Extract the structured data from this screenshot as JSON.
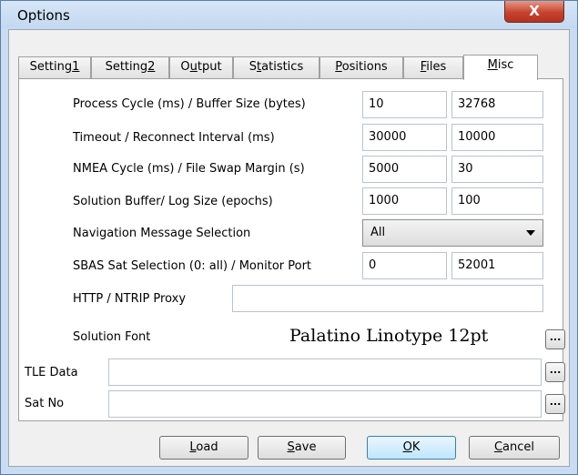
{
  "window": {
    "title": "Options",
    "close_glyph": "X"
  },
  "tabs": [
    {
      "label": "Setting1",
      "pre": "Setting",
      "accel": "1",
      "post": ""
    },
    {
      "label": "Setting2",
      "pre": "Setting",
      "accel": "2",
      "post": ""
    },
    {
      "label": "Output",
      "pre": "O",
      "accel": "u",
      "post": "tput"
    },
    {
      "label": "Statistics",
      "pre": "S",
      "accel": "t",
      "post": "atistics"
    },
    {
      "label": "Positions",
      "pre": "",
      "accel": "P",
      "post": "ositions"
    },
    {
      "label": "Files",
      "pre": "",
      "accel": "F",
      "post": "iles"
    },
    {
      "label": "Misc",
      "pre": "",
      "accel": "M",
      "post": "isc"
    }
  ],
  "active_tab": "Misc",
  "misc": {
    "process_cycle": {
      "label": "Process Cycle (ms) / Buffer Size (bytes)",
      "value1": "10",
      "value2": "32768"
    },
    "timeout": {
      "label": "Timeout / Reconnect Interval (ms)",
      "value1": "30000",
      "value2": "10000"
    },
    "nmea_cycle": {
      "label": "NMEA Cycle (ms) / File Swap Margin (s)",
      "value1": "5000",
      "value2": "30"
    },
    "solution_buffer": {
      "label": "Solution Buffer/ Log Size (epochs)",
      "value1": "1000",
      "value2": "100"
    },
    "nav_msg": {
      "label": "Navigation Message Selection",
      "selected": "All"
    },
    "sbas": {
      "label": "SBAS Sat Selection (0: all) / Monitor Port",
      "value1": "0",
      "value2": "52001"
    },
    "proxy": {
      "label": "HTTP / NTRIP Proxy",
      "value": ""
    },
    "solution_font": {
      "label": "Solution Font",
      "sample": "Palatino Linotype 12pt"
    },
    "tle_data": {
      "label": "TLE Data",
      "value": ""
    },
    "sat_no": {
      "label": "Sat No",
      "value": ""
    },
    "browse_glyph": "..."
  },
  "buttons": {
    "load": {
      "pre": "",
      "accel": "L",
      "post": "oad"
    },
    "save": {
      "pre": "",
      "accel": "S",
      "post": "ave"
    },
    "ok": {
      "pre": "",
      "accel": "O",
      "post": "K"
    },
    "cancel": {
      "pre": "",
      "accel": "C",
      "post": "ancel"
    }
  },
  "colors": {
    "title_bg": "#c9dcf2",
    "close_button": "#c7432e",
    "default_button": "#bee6fd"
  }
}
